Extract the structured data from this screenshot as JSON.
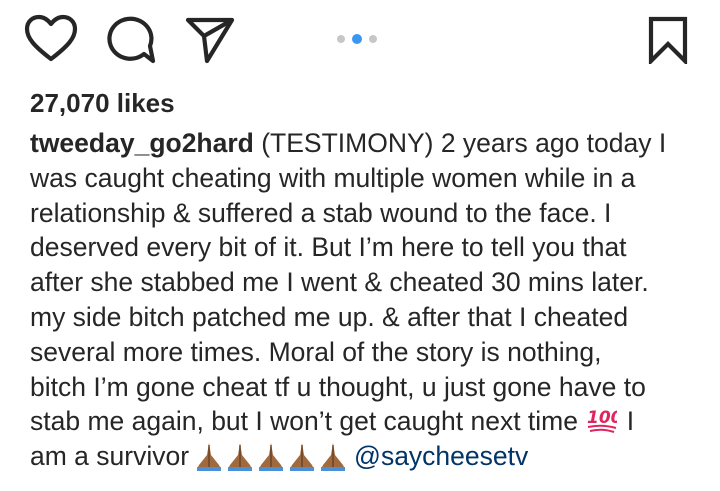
{
  "post": {
    "likes": "27,070 likes",
    "username": "tweeday_go2hard",
    "caption_lines": [
      "(TESTIMONY) 2 years ago today I",
      "was caught cheating with multiple women while in a",
      "relationship & suffered a stab wound to the face. I",
      "deserved every bit of it. But I’m here to tell you that",
      "after she stabbed me I went & cheated 30 mins later.",
      "my side bitch patched me up. & after that I cheated",
      "several more times. Moral of the story is nothing,",
      "bitch I’m gone cheat tf u thought, u just gone have to",
      "stab me again, but I won’t get caught next time",
      "I",
      "am a survivor"
    ],
    "mention": "@saycheesetv",
    "emoji_100": "💯",
    "emoji_pray": "🙏🏾"
  },
  "icons": {
    "like": "heart-icon",
    "comment": "comment-bubble-icon",
    "share": "paper-plane-icon",
    "save": "bookmark-icon"
  },
  "carousel": {
    "count": 3,
    "active_index": 1
  },
  "colors": {
    "text": "#262626",
    "mention": "#003569",
    "active_dot": "#3897f0",
    "inactive_dot": "#c7c7c7",
    "emoji_100": "#e0245e",
    "emoji_pray": "#a0693e"
  }
}
